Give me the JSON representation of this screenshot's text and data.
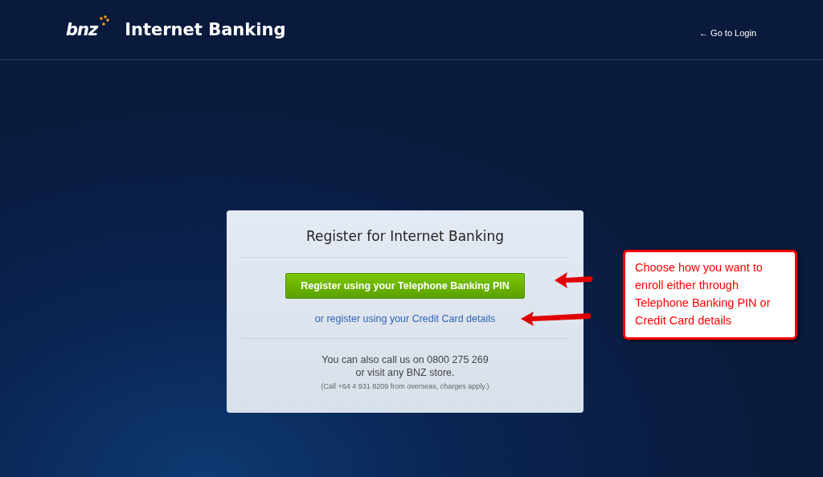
{
  "header": {
    "logo": "bnz",
    "title": "Internet Banking",
    "login_link": "← Go to Login"
  },
  "card": {
    "title": "Register for Internet Banking",
    "primary_button": "Register using your Telephone Banking PIN",
    "secondary_link": "or register using your Credit Card details",
    "contact_lines": [
      "You can also call us on 0800 275 269",
      "or visit any BNZ store."
    ],
    "overseas_note": "(Call +64 4 931 8209 from overseas, charges apply.)"
  },
  "callout": {
    "text": "Choose how you want to enroll either through Telephone Banking PIN or Credit Card details"
  }
}
